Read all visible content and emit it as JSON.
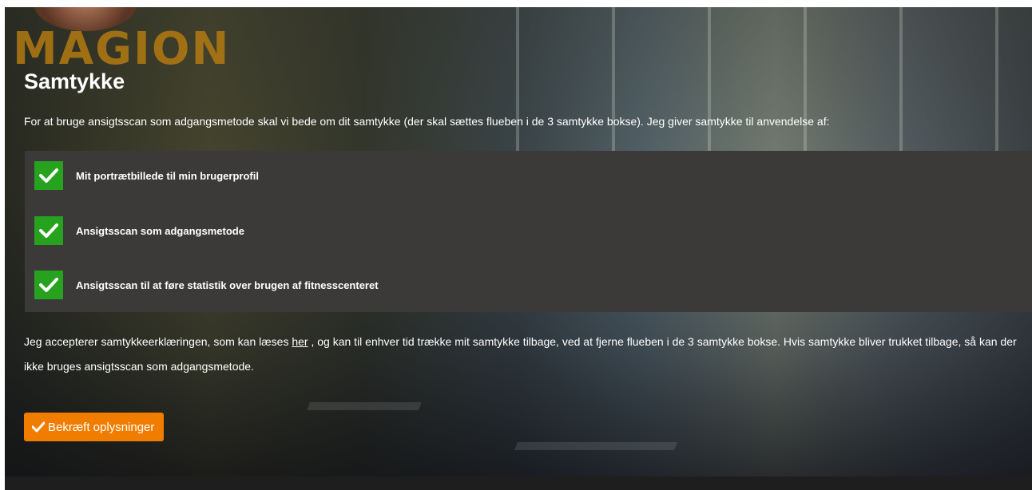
{
  "logo": {
    "text": "MAGION"
  },
  "title": "Samtykke",
  "intro": "For at bruge ansigtsscan som adgangsmetode skal vi bede om dit samtykke (der skal sættes flueben i de 3 samtykke bokse). Jeg giver samtykke til anvendelse af:",
  "consents": [
    {
      "label": "Mit portrætbillede til min brugerprofil",
      "checked": true
    },
    {
      "label": "Ansigtsscan som adgangsmetode",
      "checked": true
    },
    {
      "label": "Ansigtsscan til at føre statistik over brugen af fitnesscenteret",
      "checked": true
    }
  ],
  "terms": {
    "before_link": "Jeg accepterer samtykkeerklæringen, som kan læses ",
    "link_text": "her",
    "after_link": " , og kan til enhver tid trække mit samtykke tilbage, ved at fjerne flueben i de 3 samtykke bokse. Hvis samtykke bliver trukket tilbage, så kan der ikke bruges ansigtsscan som adgangsmetode."
  },
  "confirm_button": {
    "label": "Bekræft oplysninger",
    "icon": "checkmark-icon"
  },
  "colors": {
    "accent": "#f07d00",
    "checkbox": "#27a21f",
    "panel": "#3c3a39"
  }
}
